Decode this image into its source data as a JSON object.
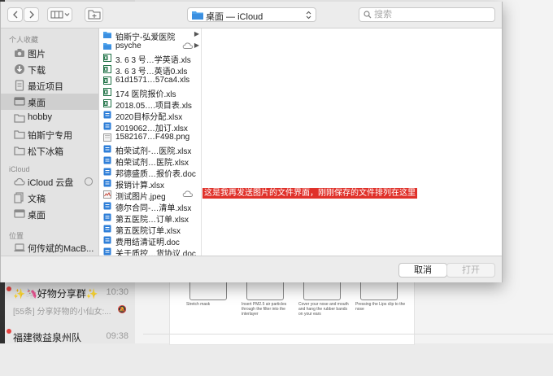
{
  "background": {
    "chats": [
      {
        "name": "✨🦄好物分享群✨",
        "time": "10:30",
        "preview": "[55条] 分享好物的小仙女:..."
      },
      {
        "name": "福建微益泉州队",
        "time": "09:38"
      }
    ],
    "image_captions": [
      "Stretch mask",
      "Insert PM2.5 air particles through the filter into the interlayer",
      "Cover your nose and mouth and hang the rubber bands on your ears",
      "Pressing the Lips clip to the nose"
    ]
  },
  "dialog": {
    "location": "桌面 — iCloud",
    "search_placeholder": "搜索",
    "sidebar": {
      "favorites_header": "个人收藏",
      "favorites": [
        {
          "label": "图片",
          "icon": "camera-icon"
        },
        {
          "label": "下载",
          "icon": "download-icon"
        },
        {
          "label": "最近项目",
          "icon": "document-icon"
        },
        {
          "label": "桌面",
          "icon": "desktop-icon",
          "selected": true
        },
        {
          "label": "hobby",
          "icon": "folder-icon"
        },
        {
          "label": "铂斯宁专用",
          "icon": "folder-icon"
        },
        {
          "label": "松下冰箱",
          "icon": "folder-icon"
        }
      ],
      "icloud_header": "iCloud",
      "icloud": [
        {
          "label": "iCloud 云盘",
          "icon": "cloud-icon"
        },
        {
          "label": "文稿",
          "icon": "documents-icon"
        },
        {
          "label": "桌面",
          "icon": "desktop-icon"
        }
      ],
      "locations_header": "位置",
      "locations": [
        {
          "label": "何传斌的MacB...",
          "icon": "laptop-icon"
        }
      ]
    },
    "files": [
      {
        "name": "铂斯宁-弘爱医院",
        "type": "folder",
        "arrow": true
      },
      {
        "name": "psyche",
        "type": "folder",
        "arrow": true,
        "cloud": true
      },
      {
        "name": "3. 6 3 号…学英语.xls",
        "type": "xls"
      },
      {
        "name": "3. 6 3 号…英语0.xls",
        "type": "xls"
      },
      {
        "name": "61d1571…57ca4.xls",
        "type": "xls"
      },
      {
        "name": "174 医院报价.xls",
        "type": "xls"
      },
      {
        "name": "2018.05….项目表.xls",
        "type": "xls"
      },
      {
        "name": "2020目标分配.xlsx",
        "type": "doc"
      },
      {
        "name": "2019062…加订.xlsx",
        "type": "doc"
      },
      {
        "name": "1582167…F498.png",
        "type": "img"
      },
      {
        "name": "柏荣试剂-…医院.xlsx",
        "type": "doc"
      },
      {
        "name": "柏荣试剂…医院.xlsx",
        "type": "doc"
      },
      {
        "name": "邦德盛质…报价表.doc",
        "type": "doc"
      },
      {
        "name": "报销计算.xlsx",
        "type": "doc"
      },
      {
        "name": "测试图片.jpeg",
        "type": "jpeg",
        "cloud": true
      },
      {
        "name": "德尔合同-…清单.xlsx",
        "type": "doc"
      },
      {
        "name": "第五医院…订单.xlsx",
        "type": "doc"
      },
      {
        "name": "第五医院订单.xlsx",
        "type": "doc"
      },
      {
        "name": "费用结清证明.doc",
        "type": "doc"
      },
      {
        "name": "关于质控…货协议.doc",
        "type": "doc"
      }
    ],
    "annotation": "这是我再发送图片的文件界面，刚刚保存的文件排列在这里",
    "cancel_label": "取消",
    "open_label": "打开"
  },
  "colors": {
    "accent_blue": "#2f7fd8",
    "annotation_red": "#e0312a",
    "excel_green": "#1e7145"
  }
}
